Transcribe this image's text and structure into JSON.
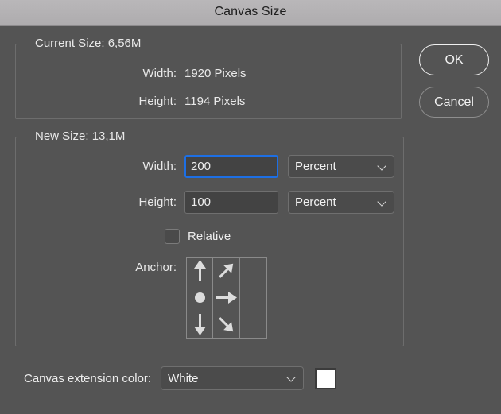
{
  "window": {
    "title": "Canvas Size"
  },
  "buttons": {
    "ok": "OK",
    "cancel": "Cancel"
  },
  "current_size": {
    "legend": "Current Size: 6,56M",
    "rows": [
      {
        "label": "Width:",
        "value": "1920 Pixels"
      },
      {
        "label": "Height:",
        "value": "1194 Pixels"
      }
    ]
  },
  "new_size": {
    "legend": "New Size: 13,1M",
    "width": {
      "label": "Width:",
      "value": "200",
      "placeholder": "",
      "unit": "Percent",
      "focused": true
    },
    "height": {
      "label": "Height:",
      "value": "100",
      "placeholder": "",
      "unit": "Percent",
      "focused": false
    },
    "relative": {
      "label": "Relative",
      "checked": false
    },
    "anchor": {
      "label": "Anchor:",
      "selected_cell": "middle-left",
      "cells": [
        {
          "icon": "arrow-up-icon"
        },
        {
          "icon": "arrow-up-right-icon"
        },
        {
          "icon": "empty"
        },
        {
          "icon": "anchor-dot-icon"
        },
        {
          "icon": "arrow-right-icon"
        },
        {
          "icon": "empty"
        },
        {
          "icon": "arrow-down-icon"
        },
        {
          "icon": "arrow-down-right-icon"
        },
        {
          "icon": "empty"
        }
      ]
    }
  },
  "canvas_extension": {
    "label": "Canvas extension color:",
    "value": "White",
    "swatch_color": "#ffffff"
  },
  "colors": {
    "dialog_background": "#545454",
    "titlebar": "#b4b2b4",
    "input_background": "#434343",
    "focus_ring": "#1d6fe4",
    "text": "#ededed"
  }
}
